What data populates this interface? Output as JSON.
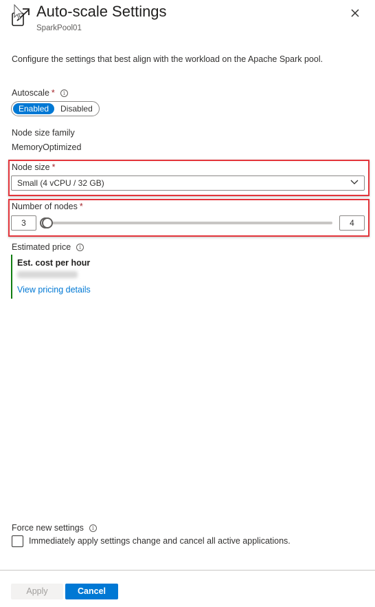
{
  "header": {
    "title": "Auto-scale Settings",
    "subtitle": "SparkPool01",
    "icon": "scale-settings-icon",
    "close_icon": "close-icon"
  },
  "description": "Configure the settings that best align with the workload on the Apache Spark pool.",
  "autoscale": {
    "label": "Autoscale",
    "required_marker": "*",
    "info_icon": "i",
    "options": [
      "Enabled",
      "Disabled"
    ],
    "selected": "Enabled"
  },
  "node_size_family": {
    "label": "Node size family",
    "value": "MemoryOptimized"
  },
  "node_size": {
    "label": "Node size",
    "required_marker": "*",
    "selected": "Small (4 vCPU / 32 GB)"
  },
  "number_of_nodes": {
    "label": "Number of nodes",
    "required_marker": "*",
    "min_value": "3",
    "max_value": "4",
    "slider_min_fraction": 0.0,
    "slider_max_fraction": 0.0
  },
  "estimated_price": {
    "label": "Estimated price",
    "info_icon": "i",
    "cost_title": "Est. cost per hour",
    "cost_value_redacted": true,
    "link_text": "View pricing details"
  },
  "force_new_settings": {
    "label": "Force new settings",
    "info_icon": "i",
    "checkbox_label": "Immediately apply settings change and cancel all active applications.",
    "checked": false
  },
  "footer": {
    "apply_label": "Apply",
    "cancel_label": "Cancel"
  },
  "colors": {
    "accent": "#0078d4",
    "required": "#a4262c",
    "highlight_box": "#e3353b",
    "price_bar": "#107c10"
  }
}
